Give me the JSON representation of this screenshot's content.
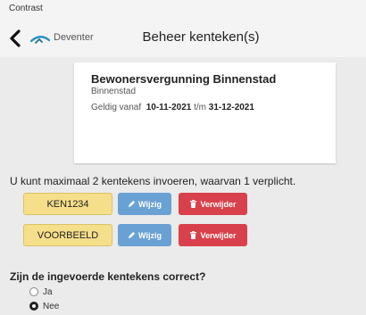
{
  "status_bar": {
    "label": "Contrast"
  },
  "header": {
    "app_name": "Deventer",
    "title": "Beheer kenteken(s)"
  },
  "permit": {
    "title": "Bewonersvergunning Binnenstad",
    "zone": "Binnenstad",
    "valid_prefix": "Geldig vanaf",
    "valid_from": "10-11-2021",
    "valid_sep": "t/m",
    "valid_to": "31-12-2021"
  },
  "info_text": "U kunt maximaal 2 kentekens invoeren, waarvan 1 verplicht.",
  "plates": [
    {
      "plate": "KEN1234",
      "edit_label": "Wijzig",
      "delete_label": "Verwijder"
    },
    {
      "plate": "VOORBEELD",
      "edit_label": "Wijzig",
      "delete_label": "Verwijder"
    }
  ],
  "question": {
    "text": "Zijn de ingevoerde kentekens correct?",
    "options": [
      {
        "label": "Ja",
        "selected": false
      },
      {
        "label": "Nee",
        "selected": true
      }
    ]
  },
  "colors": {
    "plate_bg": "#f6df8a",
    "edit_bg": "#6aa1d4",
    "delete_bg": "#d8414b",
    "logo": "#2a8fc4"
  }
}
